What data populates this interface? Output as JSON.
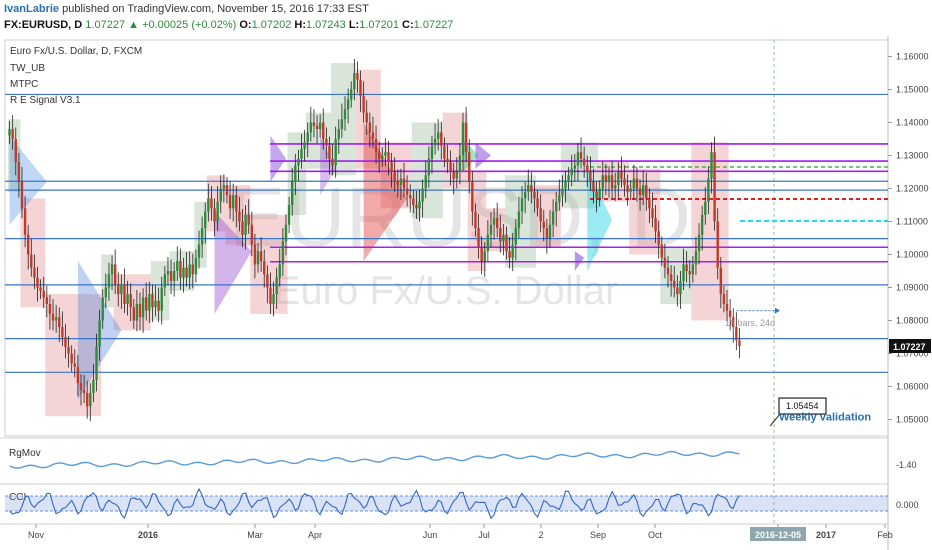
{
  "header": {
    "author": "IvanLabrie",
    "published": "published on TradingView.com, November 15, 2016 17:33 EST",
    "symbol": "FX:EURUSD, D",
    "last": "1.07227",
    "arrow": "▲",
    "change": "+0.00025 (+0.02%)",
    "o_label": "O:",
    "o": "1.07202",
    "h_label": "H:",
    "h": "1.07243",
    "l_label": "L:",
    "l": "1.07201",
    "c_label": "C:",
    "c": "1.07227"
  },
  "legend": {
    "instrument": "Euro Fx/U.S. Dollar, D, FXCM",
    "indicators": [
      "TW_UB",
      "MTPC",
      "R E Signal V3.1"
    ]
  },
  "watermark": {
    "symbol": "EURUSD, D",
    "name": "Euro Fx/U.S. Dollar"
  },
  "annotations": {
    "bars_label": "16 bars, 24d",
    "target_value": "1.05454",
    "target_text": "Weekly validation",
    "last_price_tag": "1.07227"
  },
  "panes": {
    "rgmov": "RgMov",
    "cci": "CCI",
    "rgmov_tick": "-1.40",
    "cci_tick": "0.000"
  },
  "colors": {
    "up_candle": "#2e8b3c",
    "down_candle": "#c0392b",
    "blue_line": "#3b74c9",
    "purple_line": "#a020f0",
    "red_dash": "#e02020",
    "cyan_dash": "#22d3e6",
    "green_dash": "#4caf50",
    "indicator_line": "#5a9bd8"
  },
  "chart_data": {
    "type": "candlestick",
    "title": "Euro Fx/U.S. Dollar, D, FXCM",
    "ylim": [
      1.045,
      1.165
    ],
    "yticks": [
      "1.16000",
      "1.15000",
      "1.14000",
      "1.13000",
      "1.12000",
      "1.11000",
      "1.10000",
      "1.09000",
      "1.08000",
      "1.07000",
      "1.06000",
      "1.05000"
    ],
    "xticks": [
      "Nov",
      "2016",
      "Mar",
      "Apr",
      "Jun",
      "Jul",
      "2",
      "Sep",
      "Oct",
      "2016-12-05",
      "2017",
      "Feb"
    ],
    "horizontal_levels": [
      {
        "value": 1.1485,
        "style": "blue"
      },
      {
        "value": 1.1222,
        "style": "blue"
      },
      {
        "value": 1.1195,
        "style": "blue"
      },
      {
        "value": 1.1048,
        "style": "blue"
      },
      {
        "value": 1.0908,
        "style": "blue"
      },
      {
        "value": 1.0745,
        "style": "blue"
      },
      {
        "value": 1.0643,
        "style": "blue"
      },
      {
        "value": 1.1335,
        "style": "purple"
      },
      {
        "value": 1.1283,
        "style": "purple"
      },
      {
        "value": 1.1252,
        "style": "purple"
      },
      {
        "value": 1.1022,
        "style": "purple"
      },
      {
        "value": 1.0978,
        "style": "purple"
      },
      {
        "value": 1.1265,
        "style": "green_dash"
      },
      {
        "value": 1.1168,
        "style": "red_dash"
      },
      {
        "value": 1.1102,
        "style": "cyan_dash"
      }
    ],
    "closes": [
      1.138,
      1.135,
      1.128,
      1.122,
      1.114,
      1.106,
      1.1,
      1.096,
      1.093,
      1.09,
      1.089,
      1.087,
      1.085,
      1.082,
      1.08,
      1.081,
      1.078,
      1.075,
      1.072,
      1.07,
      1.067,
      1.066,
      1.061,
      1.059,
      1.058,
      1.054,
      1.058,
      1.062,
      1.072,
      1.08,
      1.087,
      1.09,
      1.094,
      1.097,
      1.091,
      1.088,
      1.091,
      1.085,
      1.088,
      1.084,
      1.08,
      1.085,
      1.081,
      1.087,
      1.083,
      1.088,
      1.084,
      1.086,
      1.083,
      1.09,
      1.094,
      1.095,
      1.092,
      1.095,
      1.098,
      1.093,
      1.096,
      1.093,
      1.097,
      1.094,
      1.099,
      1.103,
      1.108,
      1.113,
      1.117,
      1.114,
      1.11,
      1.116,
      1.12,
      1.121,
      1.118,
      1.114,
      1.118,
      1.113,
      1.11,
      1.106,
      1.112,
      1.109,
      1.103,
      1.097,
      1.101,
      1.098,
      1.094,
      1.09,
      1.085,
      1.088,
      1.093,
      1.097,
      1.104,
      1.109,
      1.115,
      1.122,
      1.127,
      1.129,
      1.132,
      1.134,
      1.137,
      1.14,
      1.139,
      1.138,
      1.14,
      1.135,
      1.133,
      1.129,
      1.127,
      1.135,
      1.138,
      1.141,
      1.144,
      1.147,
      1.15,
      1.155,
      1.153,
      1.148,
      1.143,
      1.14,
      1.137,
      1.135,
      1.131,
      1.129,
      1.13,
      1.131,
      1.128,
      1.125,
      1.122,
      1.121,
      1.123,
      1.12,
      1.118,
      1.117,
      1.115,
      1.114,
      1.116,
      1.12,
      1.124,
      1.129,
      1.133,
      1.135,
      1.137,
      1.133,
      1.129,
      1.128,
      1.125,
      1.123,
      1.125,
      1.13,
      1.14,
      1.131,
      1.122,
      1.113,
      1.108,
      1.102,
      1.098,
      1.101,
      1.106,
      1.109,
      1.111,
      1.108,
      1.104,
      1.106,
      1.101,
      1.099,
      1.103,
      1.108,
      1.113,
      1.117,
      1.119,
      1.121,
      1.119,
      1.117,
      1.114,
      1.11,
      1.108,
      1.105,
      1.109,
      1.113,
      1.116,
      1.118,
      1.12,
      1.122,
      1.124,
      1.126,
      1.127,
      1.131,
      1.129,
      1.127,
      1.125,
      1.122,
      1.119,
      1.117,
      1.12,
      1.124,
      1.122,
      1.124,
      1.12,
      1.121,
      1.125,
      1.123,
      1.121,
      1.119,
      1.12,
      1.123,
      1.12,
      1.118,
      1.121,
      1.117,
      1.114,
      1.111,
      1.107,
      1.103,
      1.099,
      1.096,
      1.094,
      1.092,
      1.09,
      1.088,
      1.092,
      1.097,
      1.095,
      1.094,
      1.097,
      1.101,
      1.106,
      1.112,
      1.116,
      1.123,
      1.131,
      1.11,
      1.096,
      1.088,
      1.085,
      1.083,
      1.081,
      1.078,
      1.074,
      1.0723
    ]
  }
}
